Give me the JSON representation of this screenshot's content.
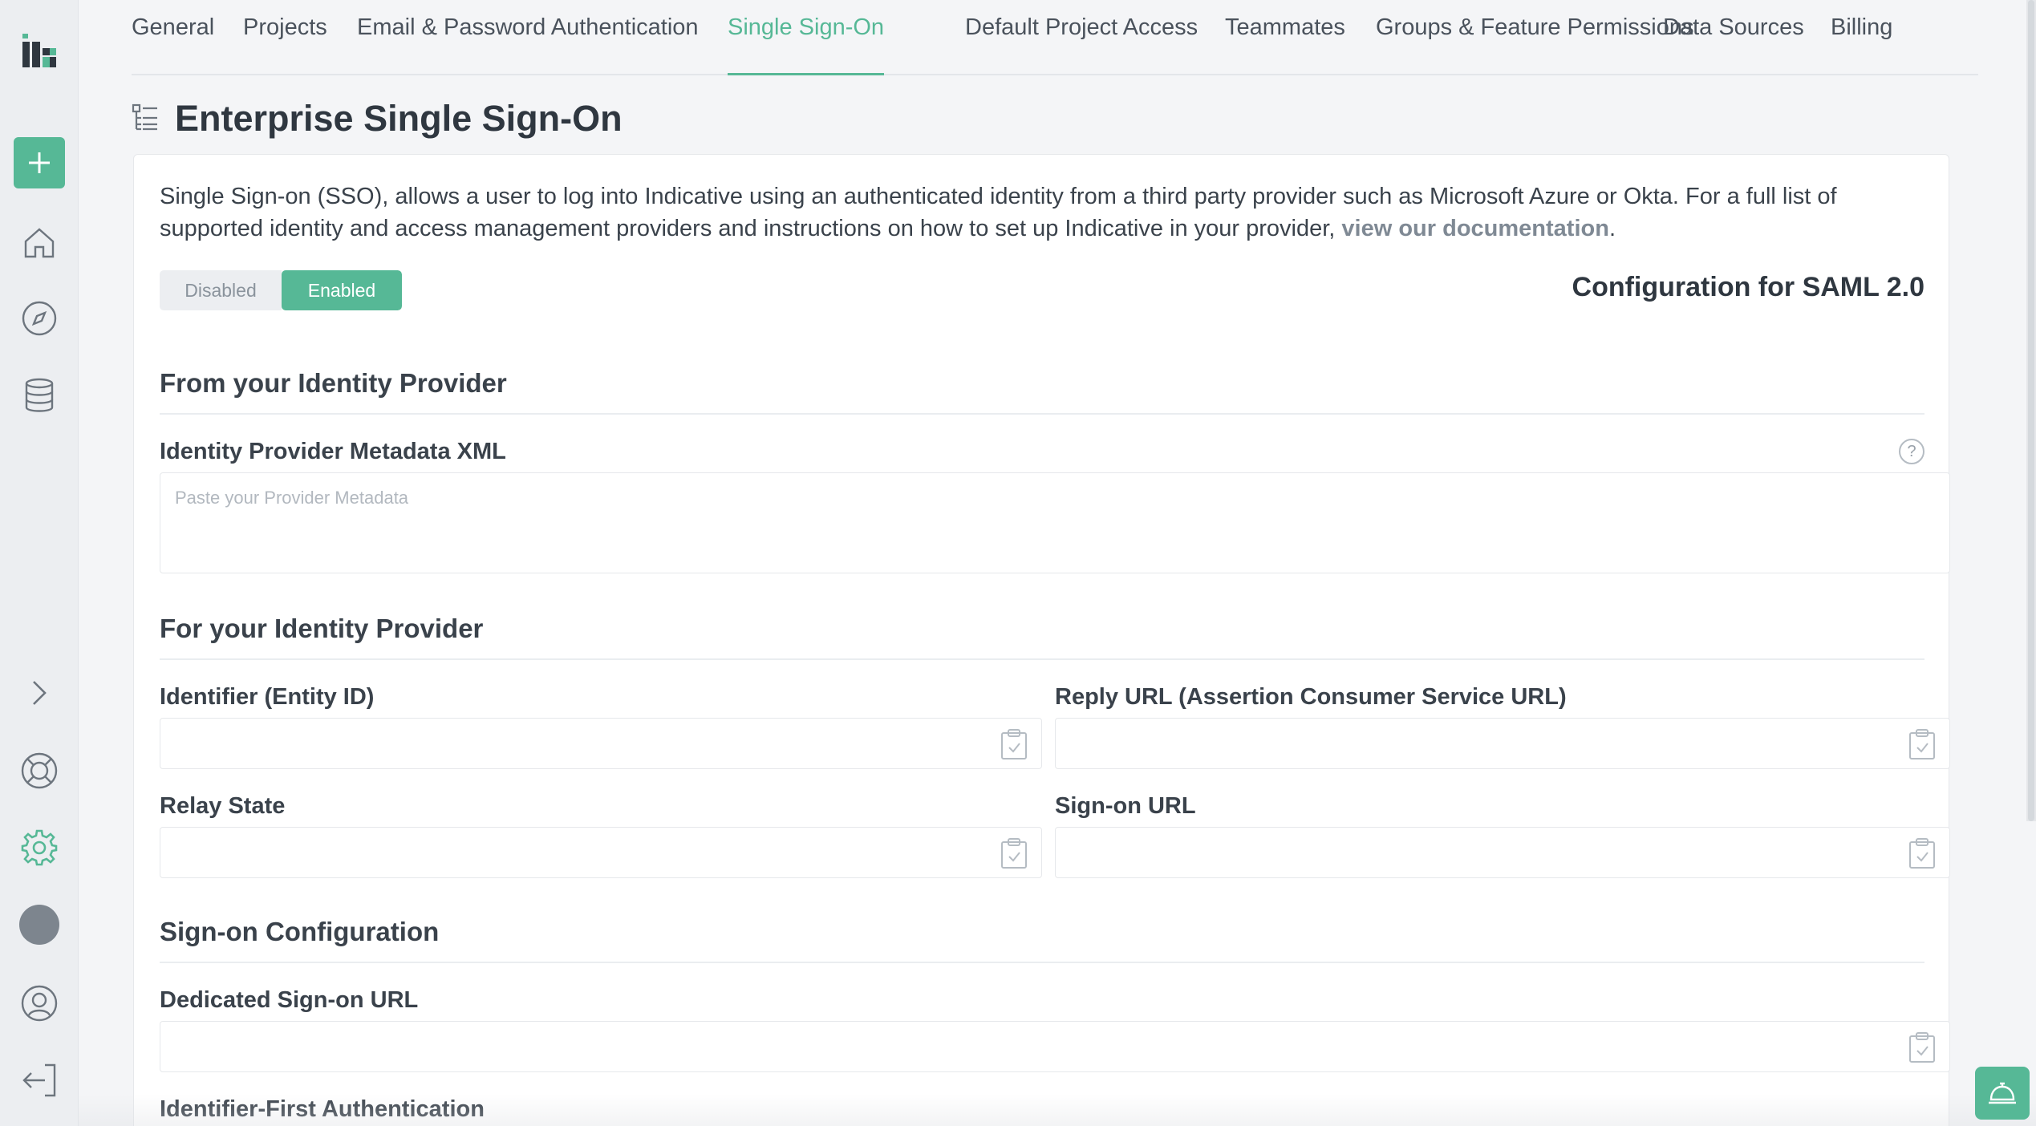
{
  "sidebar": {
    "logo_icon": "indicative-logo-icon",
    "add_icon": "plus-icon",
    "nav": [
      {
        "name": "home-icon"
      },
      {
        "name": "compass-icon"
      },
      {
        "name": "database-icon"
      }
    ],
    "expand_icon": "chevron-right-icon",
    "bottom": [
      {
        "name": "help-lifebuoy-icon"
      },
      {
        "name": "settings-gear-icon"
      },
      {
        "name": "avatar"
      },
      {
        "name": "user-profile-icon"
      },
      {
        "name": "logout-icon"
      }
    ]
  },
  "tabs": [
    {
      "label": "General"
    },
    {
      "label": "Projects"
    },
    {
      "label": "Email & Password Authentication"
    },
    {
      "label": "Single Sign-On",
      "active": true
    },
    {
      "label": "Default Project Access"
    },
    {
      "label": "Teammates"
    },
    {
      "label": "Groups & Feature Permissions"
    },
    {
      "label": "Data Sources"
    },
    {
      "label": "Billing"
    }
  ],
  "page": {
    "title": "Enterprise Single Sign-On",
    "intro_text": "Single Sign-on (SSO), allows a user to log into Indicative using an authenticated identity from a third party provider such as Microsoft Azure or Okta. For a full list of supported identity and access management providers and instructions on how to set up Indicative in your provider,",
    "intro_link": "view our documentation",
    "intro_end": ".",
    "toggle": {
      "disabled_label": "Disabled",
      "enabled_label": "Enabled",
      "selected": "Enabled"
    },
    "config_label": "Configuration for SAML 2.0"
  },
  "sections": {
    "from_idp": {
      "title": "From your Identity Provider",
      "metadata_label": "Identity Provider Metadata XML",
      "metadata_placeholder": "Paste your Provider Metadata",
      "metadata_value": ""
    },
    "for_idp": {
      "title": "For your Identity Provider",
      "entity_id_label": "Identifier (Entity ID)",
      "reply_url_label": "Reply URL (Assertion Consumer Service URL)",
      "relay_state_label": "Relay State",
      "sign_on_url_label": "Sign-on URL"
    },
    "sign_on_config": {
      "title": "Sign-on Configuration",
      "dedicated_label": "Dedicated Sign-on URL",
      "identifier_first_label": "Identifier-First Authentication"
    }
  },
  "colors": {
    "accent": "#56b896",
    "text": "#2f3740",
    "background": "#f4f5f7"
  }
}
